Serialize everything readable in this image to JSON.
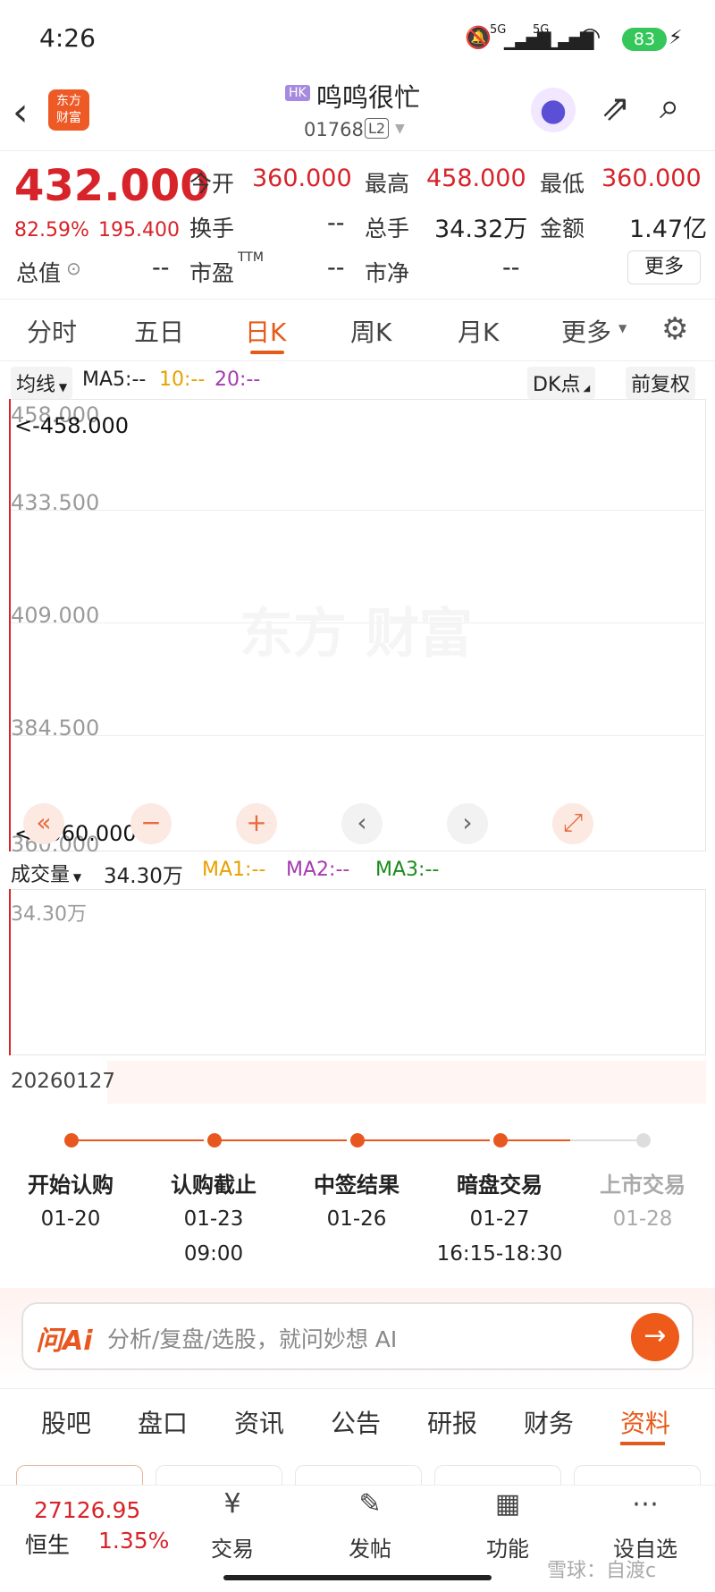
{
  "status": {
    "time": "4:26",
    "net1": "5G",
    "net2": "5G",
    "battery": "83"
  },
  "header": {
    "app_logo": "东方\n财富",
    "market_badge": "HK",
    "name": "鸣鸣很忙",
    "code": "01768",
    "level_badge": "L2"
  },
  "quote": {
    "price": "432.000",
    "change_pct": "82.59%",
    "change": "195.400",
    "open_label": "今开",
    "open": "360.000",
    "high_label": "最高",
    "high": "458.000",
    "low_label": "最低",
    "low": "360.000",
    "turnover_label": "换手",
    "turnover": "--",
    "volume_label": "总手",
    "volume": "34.32万",
    "amount_label": "金额",
    "amount": "1.47亿",
    "mktcap_label": "总值",
    "mktcap": "--",
    "pe_label": "市盈",
    "pe_sup": "TTM",
    "pe": "--",
    "pb_label": "市净",
    "pb": "--",
    "more_label": "更多"
  },
  "kline_tabs": [
    "分时",
    "五日",
    "日K",
    "周K",
    "月K",
    "更多"
  ],
  "chart": {
    "ma_selector": "均线",
    "ma5": "MA5:--",
    "ma10": "10:--",
    "ma20": "20:--",
    "dk_label": "DK点",
    "adjust_label": "前复权",
    "y_labels": [
      "458.000",
      "433.500",
      "409.000",
      "384.500",
      "360.000"
    ],
    "high_marker": "<-458.000",
    "low_marker": "<--360.000",
    "vol_selector": "成交量",
    "vol_value": "34.30万",
    "ma1": "MA1:--",
    "ma2": "MA2:--",
    "ma3": "MA3:--",
    "vol_y_label": "34.30万",
    "date_label": "20260127",
    "colors": {
      "accent": "#e8571f",
      "ma5": "#222222",
      "ma10": "#e6a100",
      "ma20": "#a63ab0",
      "ma1": "#e6a100",
      "ma2": "#a63ab0",
      "ma3": "#1a8c1a"
    }
  },
  "ipo_timeline": [
    {
      "label": "开始认购",
      "date": "01-20",
      "time": ""
    },
    {
      "label": "认购截止",
      "date": "01-23",
      "time": "09:00"
    },
    {
      "label": "中签结果",
      "date": "01-26",
      "time": ""
    },
    {
      "label": "暗盘交易",
      "date": "01-27",
      "time": "16:15-18:30"
    },
    {
      "label": "上市交易",
      "date": "01-28",
      "time": ""
    }
  ],
  "ai": {
    "logo": "问Ai",
    "placeholder": "分析/复盘/选股，就问妙想 AI"
  },
  "bottom_tabs": [
    "股吧",
    "盘口",
    "资讯",
    "公告",
    "研报",
    "财务",
    "资料"
  ],
  "footer": {
    "index_value": "27126.95",
    "index_name": "恒生",
    "index_pct": "1.35%",
    "items": [
      "交易",
      "发帖",
      "功能",
      "设自选"
    ],
    "watermark": "雪球：自渡c"
  }
}
